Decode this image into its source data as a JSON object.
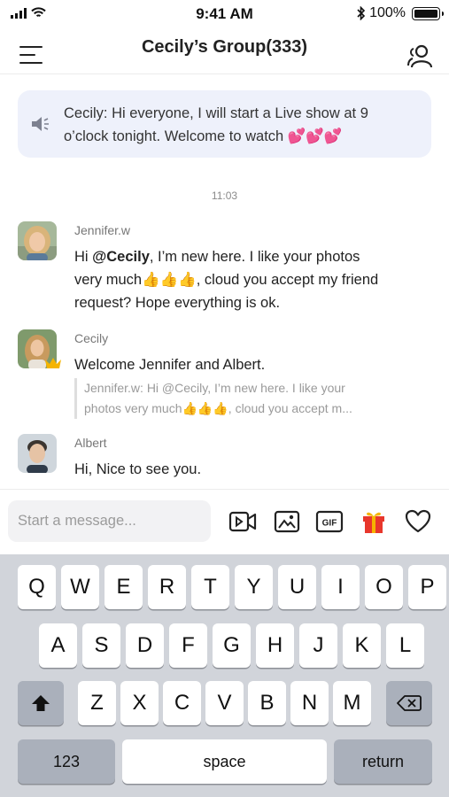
{
  "status_bar": {
    "time": "9:41 AM",
    "battery": "100%"
  },
  "nav": {
    "title": "Cecily’s Group(333)",
    "menu_icon": "menu-icon",
    "members_icon": "group-members-icon"
  },
  "notice": {
    "text": "Cecily: Hi everyone, I will start a Live show at 9 o’clock tonight. Welcome to watch",
    "emoji": "💕💕💕"
  },
  "timestamp": "11:03",
  "messages": [
    {
      "sender": "Jennifer.w",
      "greeting": "Hi ",
      "mention": "@Cecily",
      "text_1": ", I’m new here. I like your photos very much",
      "emoji": "👍👍👍",
      "text_2": ", cloud you accept my friend request? Hope everything is ok."
    },
    {
      "sender": "Cecily",
      "text": "Welcome Jennifer and Albert.",
      "quote_line1": "Jennifer.w: Hi @Cecily, I’m new here. I like your",
      "quote_line2": "photos very much👍👍👍, cloud you accept m..."
    },
    {
      "sender": "Albert",
      "text": "Hi, Nice to see you."
    }
  ],
  "composer": {
    "placeholder": "Start a message...",
    "tools": [
      "video-icon",
      "image-icon",
      "gif-icon",
      "gift-icon",
      "heart-icon"
    ],
    "gif_label": "GIF"
  },
  "keyboard": {
    "row1": [
      "Q",
      "W",
      "E",
      "R",
      "T",
      "Y",
      "U",
      "I",
      "O",
      "P"
    ],
    "row2": [
      "A",
      "S",
      "D",
      "F",
      "G",
      "H",
      "J",
      "K",
      "L"
    ],
    "row3": [
      "Z",
      "X",
      "C",
      "V",
      "B",
      "N",
      "M"
    ],
    "numbers_label": "123",
    "space_label": "space",
    "return_label": "return"
  },
  "colors": {
    "notice_bg": "#eef1fb",
    "keyboard_bg": "#d1d4da",
    "gift_red": "#e8372c",
    "crown_gold": "#f5b400"
  }
}
